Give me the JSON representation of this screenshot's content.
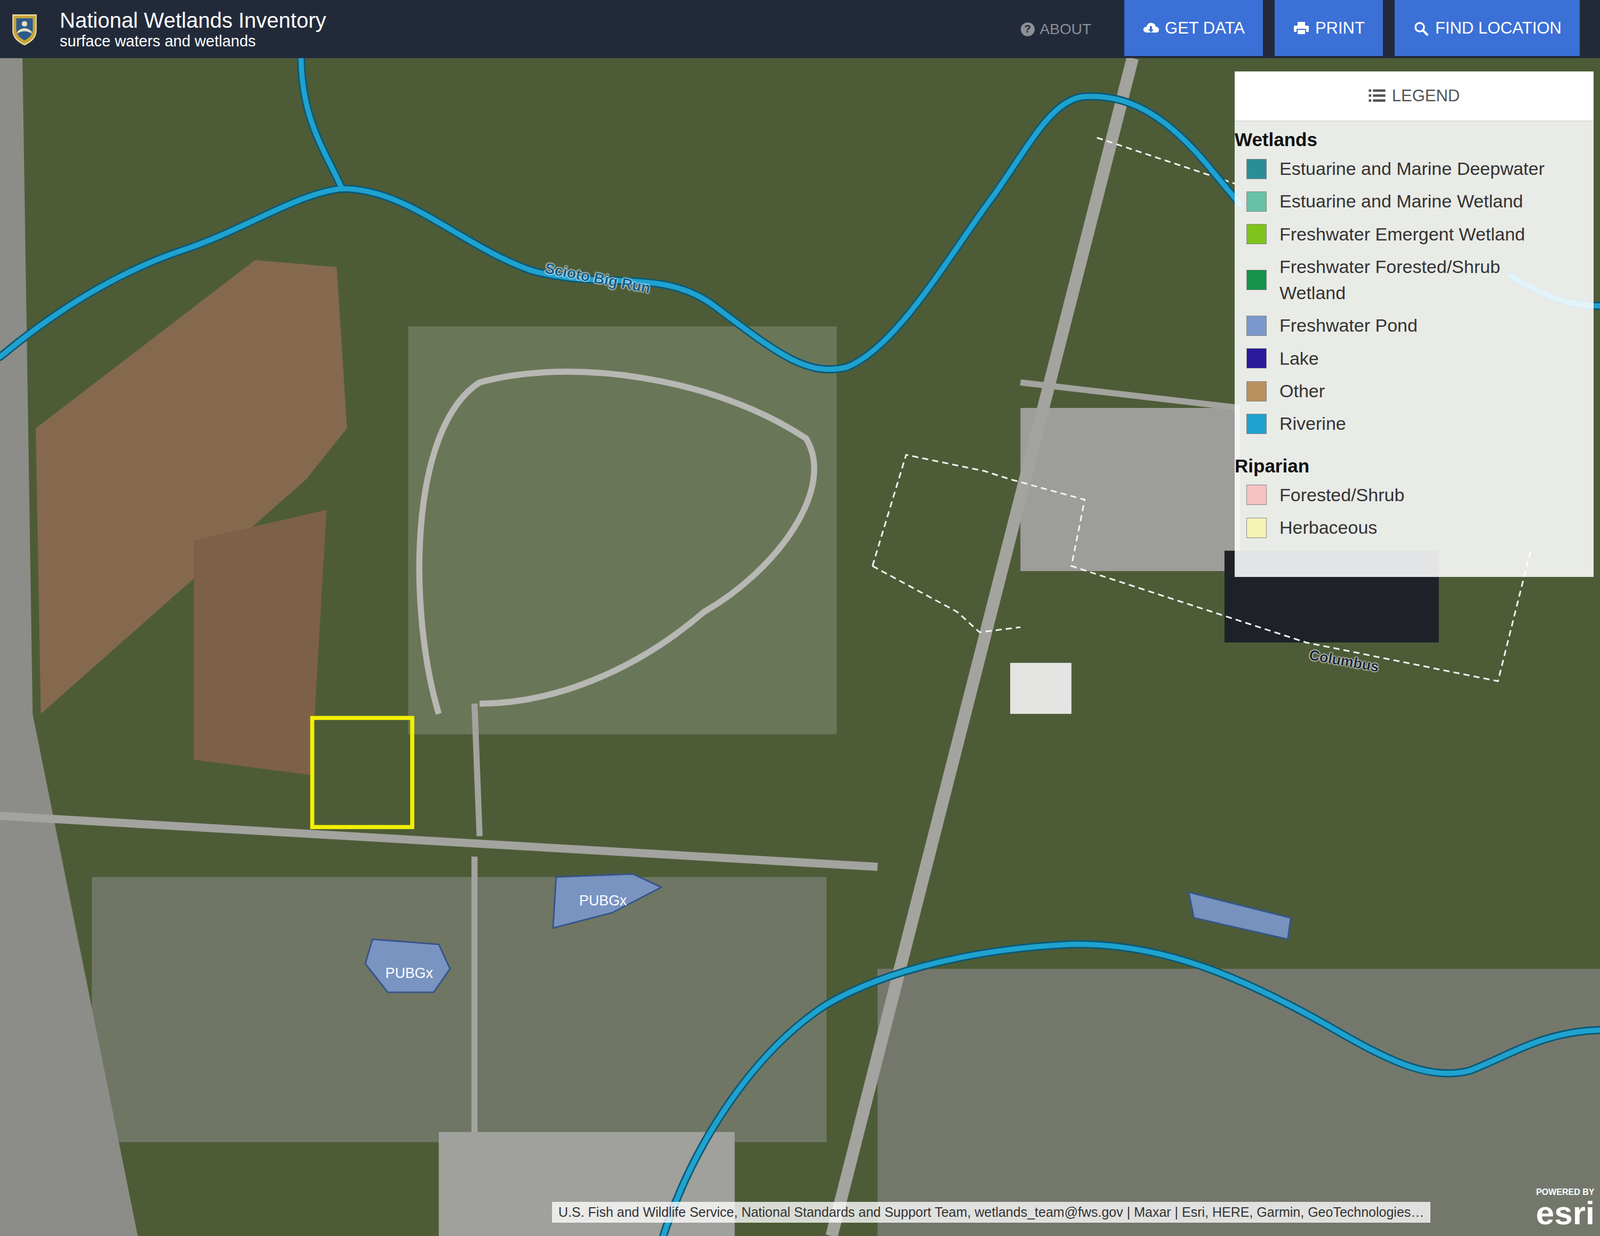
{
  "header": {
    "title": "National Wetlands Inventory",
    "subtitle": "surface waters and wetlands",
    "aboutIcon": "?",
    "about": "ABOUT",
    "buttons": [
      {
        "label": "GET DATA"
      },
      {
        "label": "PRINT"
      },
      {
        "label": "FIND LOCATION"
      }
    ]
  },
  "legend": {
    "title": "LEGEND",
    "groups": [
      {
        "title": "Wetlands",
        "items": [
          {
            "label": "Estuarine and Marine Deepwater",
            "color": "#2a8e96"
          },
          {
            "label": "Estuarine and Marine Wetland",
            "color": "#66c2a5"
          },
          {
            "label": "Freshwater Emergent Wetland",
            "color": "#7fc31c"
          },
          {
            "label": "Freshwater Forested/Shrub Wetland",
            "color": "#16924a"
          },
          {
            "label": "Freshwater Pond",
            "color": "#7b98cc"
          },
          {
            "label": "Lake",
            "color": "#2a1a9a"
          },
          {
            "label": "Other",
            "color": "#b8905e"
          },
          {
            "label": "Riverine",
            "color": "#1fa2cf"
          }
        ]
      },
      {
        "title": "Riparian",
        "items": [
          {
            "label": "Forested/Shrub",
            "color": "#f7c2c2"
          },
          {
            "label": "Herbaceous",
            "color": "#f6f3b6"
          }
        ]
      }
    ]
  },
  "map": {
    "streamLabels": [
      {
        "text": "Scioto Big Run"
      }
    ],
    "placeLabels": [
      {
        "text": "Columbus"
      }
    ],
    "ponds": [
      {
        "label": "PUBGx"
      },
      {
        "label": "PUBGx"
      },
      {
        "label": ""
      }
    ],
    "attribution": "U.S. Fish and Wildlife Service, National Standards and Support Team, wetlands_team@fws.gov | Maxar | Esri, HERE, Garmin, GeoTechnologies…",
    "poweredBy": "POWERED BY",
    "brand": "esri"
  }
}
